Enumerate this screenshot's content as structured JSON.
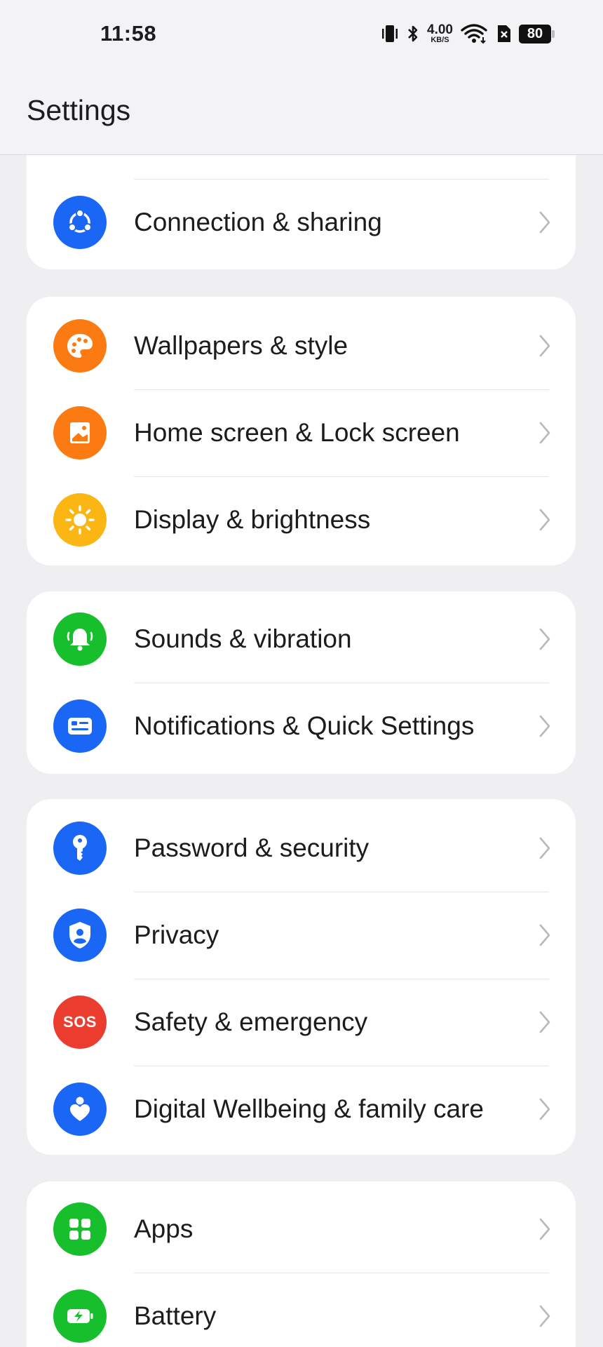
{
  "status_bar": {
    "time": "11:58",
    "net_speed_value": "4.00",
    "net_speed_unit": "KB/S",
    "battery_level": "80"
  },
  "header": {
    "title": "Settings"
  },
  "colors": {
    "blue": "#1a66f5",
    "orange": "#fb7a12",
    "yellow": "#fbb614",
    "green": "#18bf2c",
    "red": "#eb3d2f"
  },
  "groups": [
    {
      "items": [
        {
          "label": "Connection & sharing",
          "icon": "share-icon",
          "color": "#1a66f5"
        }
      ]
    },
    {
      "items": [
        {
          "label": "Wallpapers & style",
          "icon": "palette-icon",
          "color": "#fb7a12"
        },
        {
          "label": "Home screen & Lock screen",
          "icon": "image-icon",
          "color": "#fb7a12"
        },
        {
          "label": "Display & brightness",
          "icon": "sun-icon",
          "color": "#fbb614"
        }
      ]
    },
    {
      "items": [
        {
          "label": "Sounds & vibration",
          "icon": "bell-icon",
          "color": "#18bf2c"
        },
        {
          "label": "Notifications & Quick Settings",
          "icon": "notification-card-icon",
          "color": "#1a66f5"
        }
      ]
    },
    {
      "items": [
        {
          "label": "Password & security",
          "icon": "key-icon",
          "color": "#1a66f5"
        },
        {
          "label": "Privacy",
          "icon": "shield-user-icon",
          "color": "#1a66f5"
        },
        {
          "label": "Safety & emergency",
          "icon": "sos-icon",
          "color": "#eb3d2f",
          "icon_text": "SOS"
        },
        {
          "label": "Digital Wellbeing & family care",
          "icon": "heart-person-icon",
          "color": "#1a66f5"
        }
      ]
    },
    {
      "items": [
        {
          "label": "Apps",
          "icon": "apps-grid-icon",
          "color": "#18bf2c"
        },
        {
          "label": "Battery",
          "icon": "battery-charging-icon",
          "color": "#18bf2c"
        }
      ]
    }
  ]
}
